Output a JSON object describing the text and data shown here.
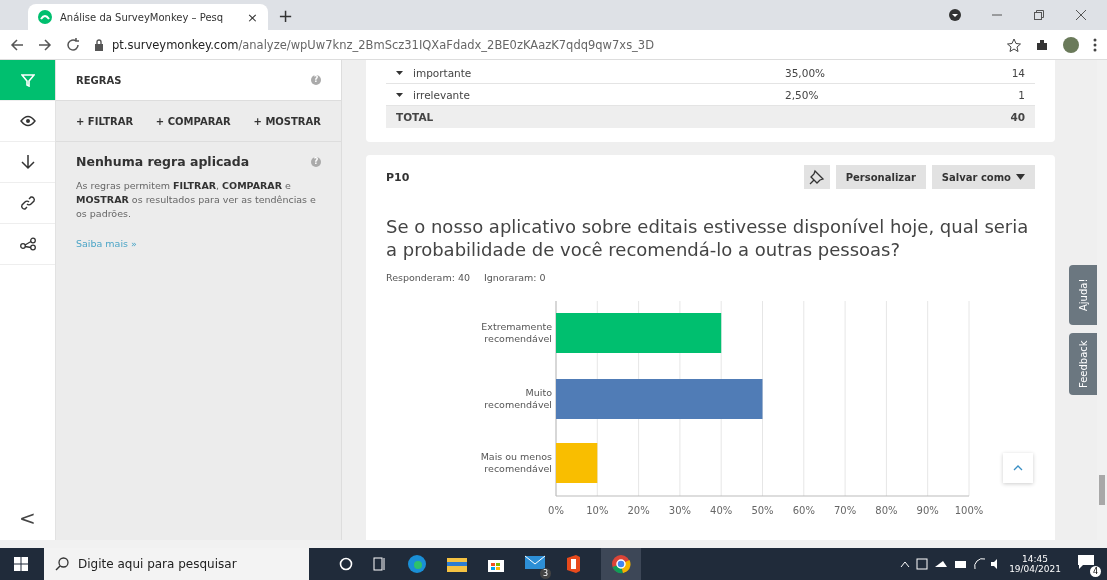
{
  "browser": {
    "tab_title": "Análise da SurveyMonkey – Pesq",
    "tab_close": "×",
    "new_tab": "+",
    "url_host": "pt.surveymonkey.com",
    "url_path": "/analyze/wpUw7knz_2BmScz31IQXaFdadx_2BE0zKAazK7qdq9qw7xs_3D"
  },
  "rail": [
    {
      "kind": "filter",
      "selected": true
    },
    {
      "kind": "eye",
      "selected": false
    },
    {
      "kind": "download",
      "selected": false
    },
    {
      "kind": "link",
      "selected": false
    },
    {
      "kind": "share",
      "selected": false
    }
  ],
  "rail_collapse": "<",
  "rules_panel": {
    "help_icon": "?",
    "title": "REGRAS",
    "actions": [
      "+ FILTRAR",
      "+ COMPARAR",
      "+ MOSTRAR"
    ],
    "heading": "Nenhuma regra aplicada",
    "description": "As regras permitem **FILTRAR**, **COMPARAR** e **MOSTRAR** os resultados para ver as tendências e os padrões.",
    "link": "Saiba mais »"
  },
  "previous_table": {
    "rows": [
      {
        "label": "importante",
        "percent": "35,00%",
        "count": "14"
      },
      {
        "label": "irrelevante",
        "percent": "2,50%",
        "count": "1"
      }
    ],
    "total": {
      "label": "TOTAL",
      "count": "40"
    }
  },
  "question": {
    "number": "P10",
    "buttons": [
      "Personalizar",
      "Salvar como"
    ],
    "title": "Se o nosso  aplicativo sobre editais estivesse disponível hoje, qual seria a probabilidade de você recomendá-lo a outras pessoas?",
    "answered": "Responderam: 40",
    "skipped": "Ignoraram: 0",
    "chart_data": {
      "type": "bar",
      "orientation": "horizontal",
      "categories": [
        "Extremamente recomendável",
        "Muito recomendável",
        "Mais ou menos recomendável"
      ],
      "stacked": true,
      "grid": true,
      "series": [
        {
          "color": "#00bf6f",
          "values": [
            40,
            null,
            null
          ]
        },
        {
          "color": "#507cb6",
          "values": [
            null,
            50,
            null
          ]
        },
        {
          "color": "#f9be00",
          "values": [
            null,
            null,
            10
          ]
        }
      ],
      "xlim": [
        0,
        100
      ],
      "xticks": [
        {
          "value": 0,
          "label": "0%"
        },
        {
          "value": 10,
          "label": "10%"
        },
        {
          "value": 20,
          "label": "20%"
        },
        {
          "value": 30,
          "label": "30%"
        },
        {
          "value": 40,
          "label": "40%"
        },
        {
          "value": 50,
          "label": "50%"
        },
        {
          "value": 60,
          "label": "60%"
        },
        {
          "value": 70,
          "label": "70%"
        },
        {
          "value": 80,
          "label": "80%"
        },
        {
          "value": 90,
          "label": "90%"
        },
        {
          "value": 100,
          "label": "100%"
        }
      ]
    }
  },
  "side_tabs": [
    "Ajuda!",
    "Feedback"
  ],
  "taskbar": {
    "search_placeholder": "Digite aqui para pesquisar",
    "mail_badge": "3",
    "time": "14:45",
    "date": "19/04/2021",
    "notification_badge": "4"
  }
}
